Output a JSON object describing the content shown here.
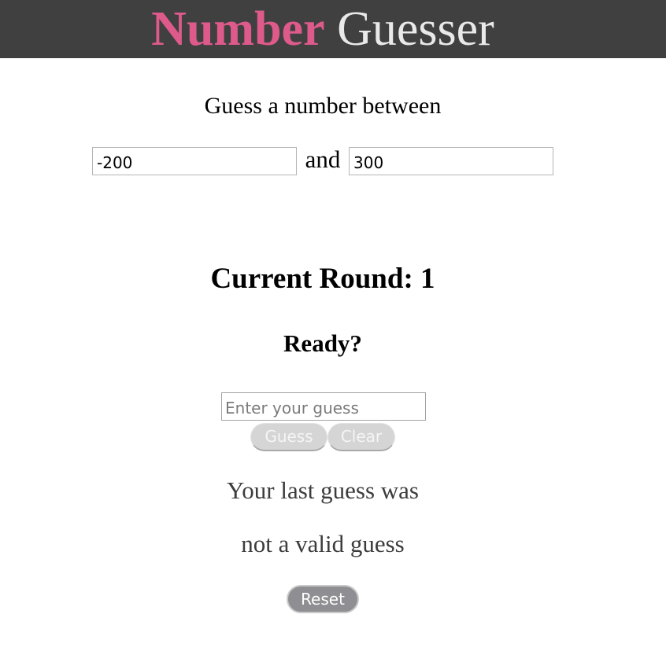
{
  "header": {
    "title_part1": "Number",
    "title_part2": "Guesser",
    "colors": {
      "background": "#404040",
      "title_part1": "#dd5a8b",
      "title_part2": "#e9e9e9"
    }
  },
  "range": {
    "prompt": "Guess a number between",
    "min_value": "-200",
    "conjunction": "and",
    "max_value": "300"
  },
  "game": {
    "round_label": "Current Round: 1",
    "status": "Ready?",
    "guess_placeholder": "Enter your guess",
    "guess_value": "",
    "guess_button": "Guess",
    "clear_button": "Clear",
    "last_guess_label": "Your last guess was",
    "last_guess_value": "not a valid guess",
    "reset_button": "Reset"
  }
}
